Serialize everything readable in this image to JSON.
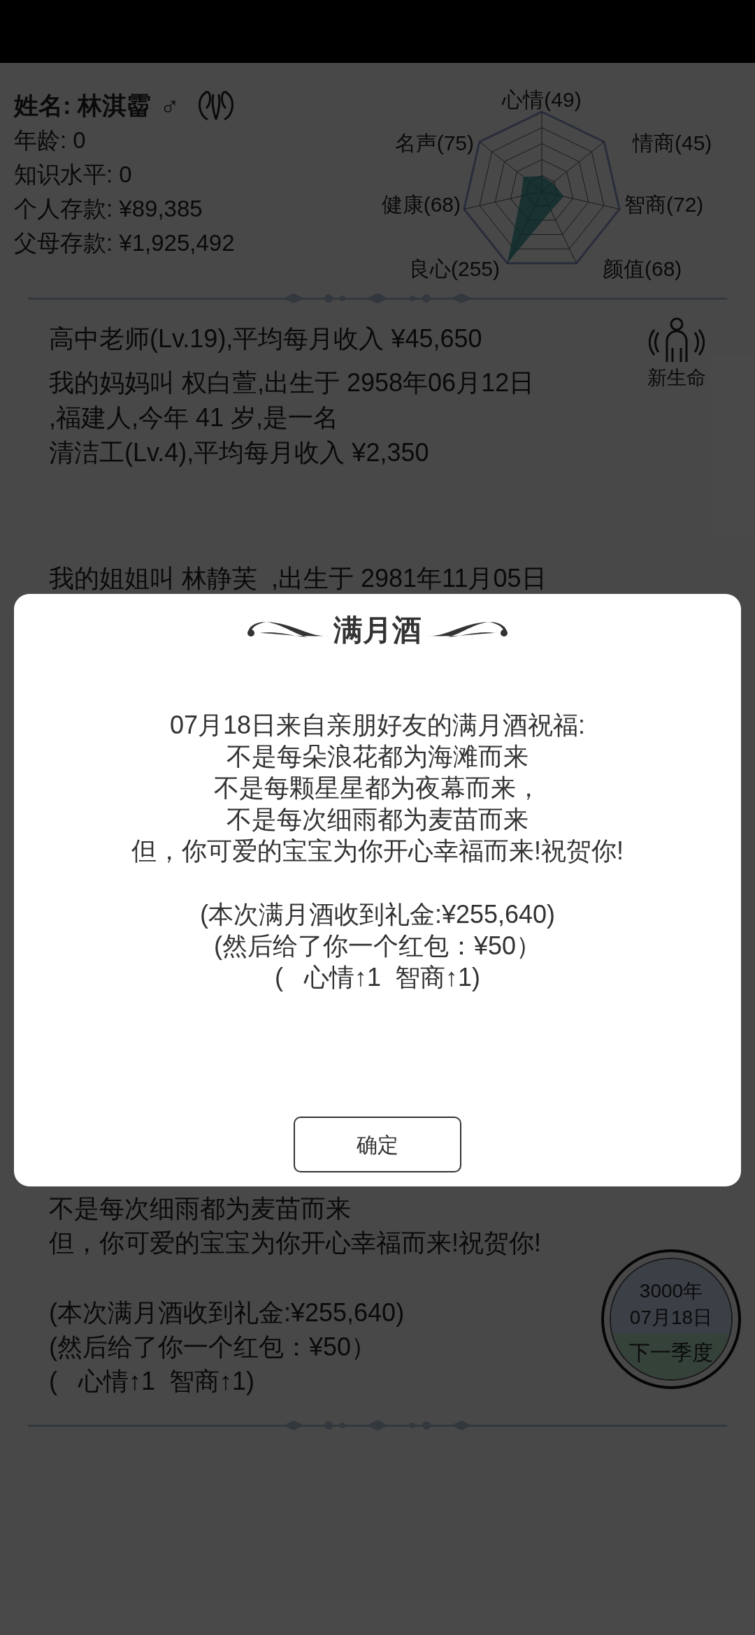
{
  "profile": {
    "name": "姓名: 林淇霤",
    "gender": "♂",
    "lines": [
      "年龄: 0",
      "知识水平: 0",
      "个人存款: ¥89,385",
      "父母存款: ¥1,925,492"
    ]
  },
  "stats": [
    "心情(49)",
    "名声(75)",
    "情商(45)",
    "健康(68)",
    "智商(72)",
    "良心(255)",
    "颜值(68)"
  ],
  "story_top": [
    [
      "高中老师(Lv.19),平均每月收入 ¥45,650"
    ],
    [
      "我的妈妈叫 权白萱,出生于 2958年06月12日",
      ",福建人,今年 41 岁,是一名",
      "清洁工(Lv.4),平均每月收入 ¥2,350"
    ],
    [
      "我的姐姐叫 林静芙  ,出生于 2981年11月05日"
    ]
  ],
  "story_bottom": [
    [
      "不是每次细雨都为麦苗而来",
      "但，你可爱的宝宝为你开心幸福而来!祝贺你!"
    ],
    [
      "(本次满月酒收到礼金:¥255,640)",
      "(然后给了你一个红包：¥50）",
      "(   心情↑1  智商↑1)"
    ]
  ],
  "new_life_button": "新生命",
  "date_button": {
    "year": "3000年",
    "date": "07月18日",
    "action": "下一季度"
  },
  "dialog": {
    "title": "满月酒",
    "paragraphs": [
      [
        "07月18日来自亲朋好友的满月酒祝福:",
        "不是每朵浪花都为海滩而来",
        "不是每颗星星都为夜幕而来，",
        "不是每次细雨都为麦苗而来",
        "但，你可爱的宝宝为你开心幸福而来!祝贺你!"
      ],
      [
        "(本次满月酒收到礼金:¥255,640)",
        "(然后给了你一个红包：¥50）",
        "(   心情↑1  智商↑1)"
      ]
    ],
    "button": "确定"
  }
}
